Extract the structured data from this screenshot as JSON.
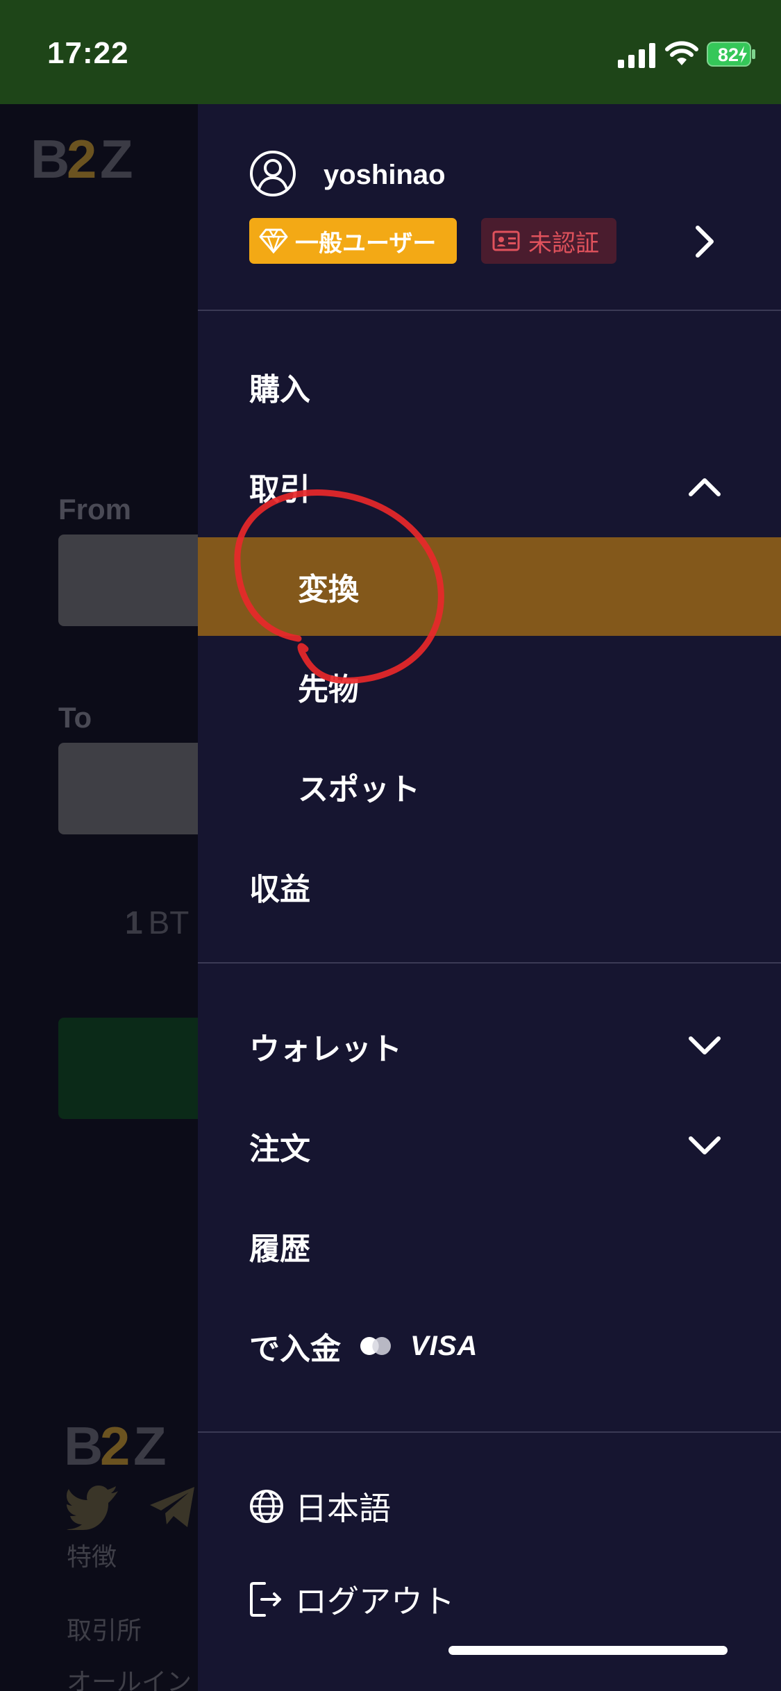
{
  "status_bar": {
    "time": "17:22",
    "battery_percent": "82",
    "icons": [
      "signal-icon",
      "wifi-icon",
      "battery-charging-icon"
    ]
  },
  "background_page": {
    "logo": "B2Z",
    "from_label": "From",
    "to_label": "To",
    "rate_number": "1",
    "rate_unit": "BT",
    "footer_logo": "B2Z",
    "footer_section_title": "特徴",
    "footer_links": [
      "取引所",
      "オールイン"
    ]
  },
  "drawer": {
    "username": "yoshinao",
    "level_badge": "一般ユーザー",
    "kyc_badge": "未認証",
    "menu": {
      "buy": "購入",
      "trade": "取引",
      "trade_sub": {
        "convert": "変換",
        "futures": "先物",
        "spot": "スポット"
      },
      "earn": "収益",
      "wallet": "ウォレット",
      "orders": "注文",
      "history": "履歴",
      "deposit": "で入金",
      "deposit_card_brand": "VISA"
    },
    "language": "日本語",
    "logout": "ログアウト"
  },
  "colors": {
    "status_bar_bg": "#1e4518",
    "drawer_bg": "#161530",
    "active_item_bg": "#83581b",
    "level_badge_bg": "#f3a915",
    "kyc_badge_bg": "#4a1c2e",
    "kyc_badge_text": "#e0525c",
    "annotation_red": "#e8282a"
  }
}
